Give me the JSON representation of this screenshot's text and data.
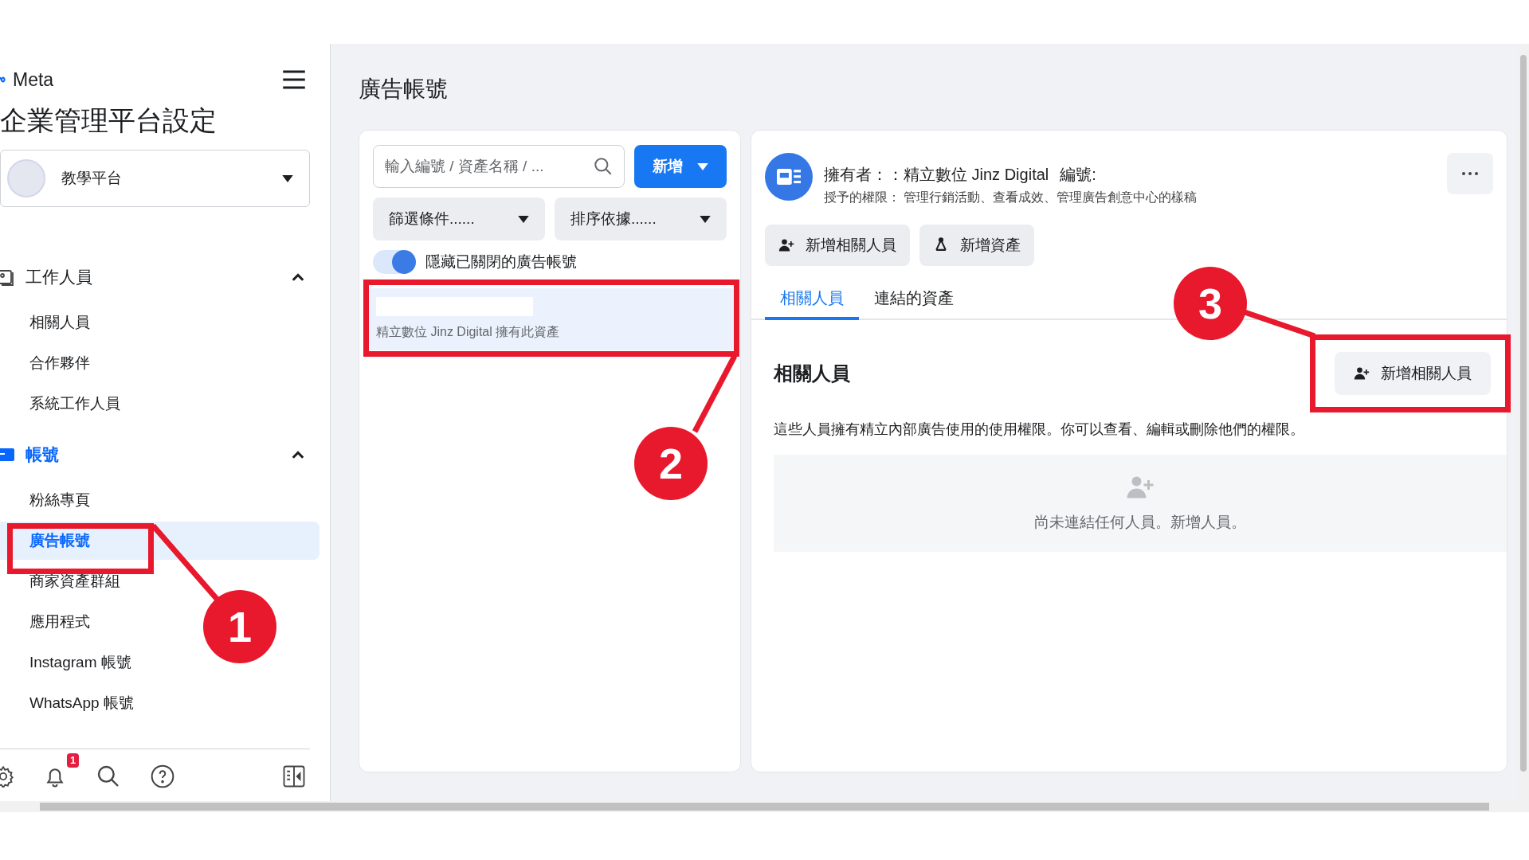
{
  "sidebar": {
    "brand": "Meta",
    "title": "企業管理平台設定",
    "business": {
      "name": "教學平台"
    },
    "sections": [
      {
        "label": "工作人員",
        "kind": "people",
        "expanded": true,
        "selected": false,
        "items": [
          {
            "label": "相關人員",
            "selected": false
          },
          {
            "label": "合作夥伴",
            "selected": false
          },
          {
            "label": "系統工作人員",
            "selected": false
          }
        ]
      },
      {
        "label": "帳號",
        "kind": "accounts",
        "expanded": true,
        "selected": true,
        "items": [
          {
            "label": "粉絲專頁",
            "selected": false
          },
          {
            "label": "廣告帳號",
            "selected": true
          },
          {
            "label": "商家資產群組",
            "selected": false
          },
          {
            "label": "應用程式",
            "selected": false
          },
          {
            "label": "Instagram 帳號",
            "selected": false
          },
          {
            "label": "WhatsApp 帳號",
            "selected": false
          }
        ]
      }
    ],
    "notification_count": "1"
  },
  "page": {
    "title": "廣告帳號"
  },
  "list_panel": {
    "search": {
      "placeholder": "輸入編號 / 資產名稱 / ..."
    },
    "add_button": "新增",
    "filter": "篩選條件......",
    "sort": "排序依據......",
    "hide_closed": {
      "label": "隱藏已關閉的廣告帳號",
      "on": true
    },
    "accounts": [
      {
        "owner_note": "精立數位 Jinz Digital 擁有此資產",
        "selected": true
      }
    ]
  },
  "detail": {
    "owner": "擁有者：：精立數位 Jinz Digital",
    "id_label": "編號:",
    "permissions": "授予的權限： 管理行銷活動、查看成效、管理廣告創意中心的樣稿",
    "actions": [
      {
        "label": "新增相關人員",
        "kind": "person"
      },
      {
        "label": "新增資產",
        "kind": "asset"
      }
    ],
    "tabs": [
      {
        "label": "相關人員",
        "selected": true
      },
      {
        "label": "連結的資產",
        "selected": false
      }
    ],
    "section_title": "相關人員",
    "section_button": "新增相關人員",
    "description": "這些人員擁有精立內部廣告使用的使用權限。你可以查看、編輯或刪除他們的權限。",
    "empty_state": "尚未連結任何人員。新增人員。"
  },
  "annotations": [
    {
      "label": "1"
    },
    {
      "label": "2"
    },
    {
      "label": "3"
    }
  ]
}
